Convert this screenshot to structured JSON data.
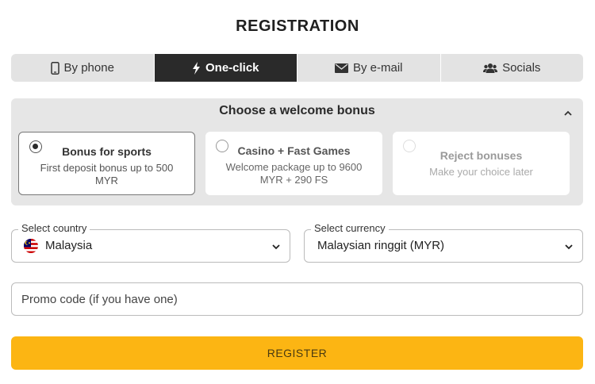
{
  "page": {
    "title": "REGISTRATION"
  },
  "tabs": [
    {
      "label": "By phone",
      "icon": "phone-icon",
      "active": false
    },
    {
      "label": "One-click",
      "icon": "lightning-icon",
      "active": true
    },
    {
      "label": "By e-mail",
      "icon": "envelope-icon",
      "active": false
    },
    {
      "label": "Socials",
      "icon": "users-icon",
      "active": false
    }
  ],
  "bonus": {
    "header": "Choose a welcome bonus",
    "options": [
      {
        "title": "Bonus for sports",
        "subtitle": "First deposit bonus up to 500 MYR",
        "selected": true
      },
      {
        "title": "Casino + Fast Games",
        "subtitle": "Welcome package up to 9600 MYR + 290 FS",
        "selected": false
      },
      {
        "title": "Reject bonuses",
        "subtitle": "Make your choice later",
        "selected": false
      }
    ]
  },
  "country": {
    "label": "Select country",
    "value": "Malaysia",
    "flag_icon": "malaysia-flag-icon"
  },
  "currency": {
    "label": "Select currency",
    "value": "Malaysian ringgit (MYR)"
  },
  "promo": {
    "placeholder": "Promo code (if you have one)"
  },
  "register": {
    "label": "REGISTER"
  },
  "colors": {
    "accent": "#fcb513",
    "active_tab": "#2a2a2a",
    "panel_bg": "#e6e6e6"
  }
}
